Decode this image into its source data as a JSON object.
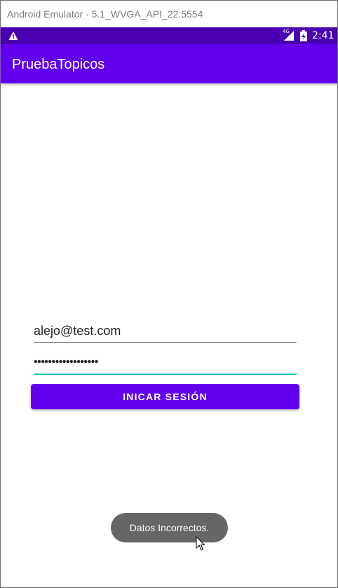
{
  "window": {
    "title": "Android Emulator - 5.1_WVGA_API_22:5554"
  },
  "status_bar": {
    "network_label": "4G",
    "time": "2:41",
    "icons": [
      "warning-icon",
      "signal-icon",
      "battery-charging-icon"
    ],
    "background_color": "#4a00b0"
  },
  "app_bar": {
    "title": "PruebaTopicos",
    "background_color": "#6200ee"
  },
  "login_form": {
    "email_value": "alejo@test.com",
    "password_value": "••••••••••••••••••",
    "accent_color": "#18c1c6",
    "submit_label": "INICAR SESIÓN"
  },
  "toast": {
    "message": "Datos Incorrectos."
  }
}
